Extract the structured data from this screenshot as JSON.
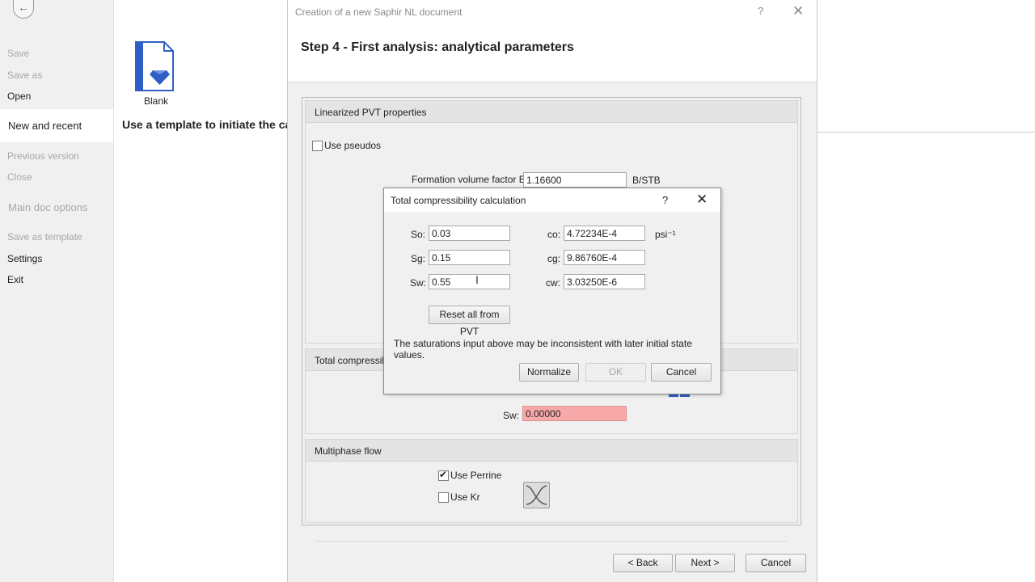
{
  "sidebar": {
    "items": [
      {
        "label": "Save",
        "enabled": false
      },
      {
        "label": "Save as",
        "enabled": false
      },
      {
        "label": "Open",
        "enabled": true
      },
      {
        "label": "New and recent",
        "enabled": true,
        "selected": true
      },
      {
        "label": "Previous version",
        "enabled": false
      },
      {
        "label": "Close",
        "enabled": false
      },
      {
        "label": "Main doc options",
        "enabled": false
      },
      {
        "label": "Save as template",
        "enabled": false
      },
      {
        "label": "Settings",
        "enabled": true
      },
      {
        "label": "Exit",
        "enabled": true
      }
    ],
    "back_icon": "arrow-left-icon"
  },
  "background": {
    "blank_label": "Blank",
    "template_text": "Use a template to initiate the cas"
  },
  "wizard": {
    "window_title": "Creation of a new Saphir NL document",
    "help": "?",
    "close": "✕",
    "step_title": "Step 4 - First analysis: analytical parameters",
    "pvt_group": {
      "title": "Linearized PVT properties",
      "use_pseudos_label": "Use pseudos",
      "use_pseudos_checked": false,
      "fvf_label": "Formation volume factor B:",
      "fvf_value": "1.16600",
      "fvf_unit": "B/STB"
    },
    "compress_group": {
      "title": "Total compressibili",
      "sw_label": "Sw:",
      "sw_value": "0.00000"
    },
    "multiphase_group": {
      "title": "Multiphase flow",
      "use_perrine_label": "Use Perrine",
      "use_perrine_checked": true,
      "use_kr_label": "Use Kr",
      "use_kr_checked": false
    },
    "buttons": {
      "back": "< Back",
      "next": "Next >",
      "cancel": "Cancel"
    }
  },
  "dialog": {
    "title": "Total compressibility calculation",
    "help": "?",
    "close": "✕",
    "so_label": "So:",
    "so_value": "0.03",
    "sg_label": "Sg:",
    "sg_value": "0.15",
    "sw_label": "Sw:",
    "sw_value": "0.55",
    "co_label": "co:",
    "co_value": "4.72234E-4",
    "cg_label": "cg:",
    "cg_value": "9.86760E-4",
    "cw_label": "cw:",
    "cw_value": "3.03250E-6",
    "unit": "psi⁻¹",
    "reset_label": "Reset all from PVT",
    "warning": "The saturations input above may be inconsistent with later initial state values.",
    "normalize_label": "Normalize",
    "ok_label": "OK",
    "cancel_label": "Cancel"
  },
  "colors": {
    "invalid_field": "#f7a9a9",
    "accent_blue": "#2f5fc4"
  }
}
